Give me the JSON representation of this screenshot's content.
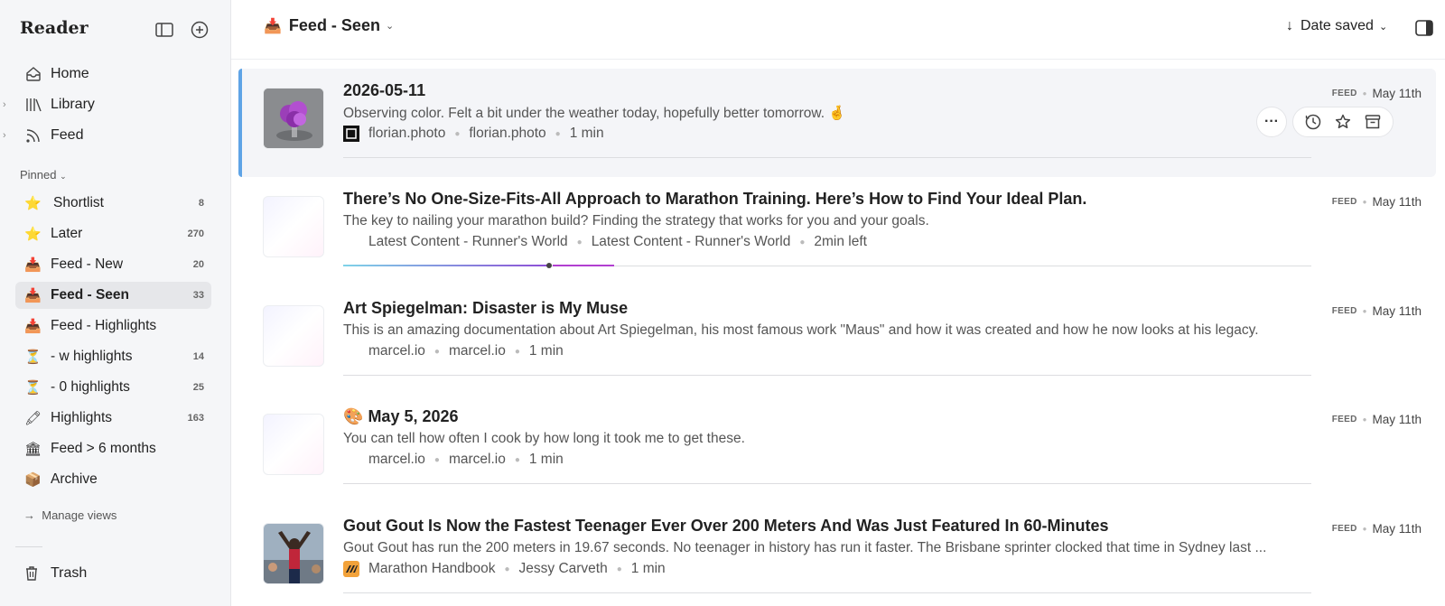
{
  "sidebar": {
    "app_title": "Reader",
    "nav": [
      {
        "label": "Home",
        "icon": "home-icon",
        "expandable": false
      },
      {
        "label": "Library",
        "icon": "library-icon",
        "expandable": true
      },
      {
        "label": "Feed",
        "icon": "rss-icon",
        "expandable": true
      }
    ],
    "pinned_label": "Pinned",
    "views": [
      {
        "label": "Shortlist",
        "count": "8",
        "icon": "star-icon",
        "glyph": "⭐"
      },
      {
        "label": "Later",
        "count": "270",
        "icon": "star-icon",
        "glyph": "⭐"
      },
      {
        "label": "Feed - New",
        "count": "20",
        "icon": "inbox-tray-icon",
        "glyph": "📥"
      },
      {
        "label": "Feed - Seen",
        "count": "33",
        "icon": "inbox-tray-icon",
        "glyph": "📥",
        "active": true
      },
      {
        "label": "Feed - Highlights",
        "count": "",
        "icon": "inbox-tray-icon",
        "glyph": "📥"
      },
      {
        "label": "- w highlights",
        "count": "14",
        "icon": "hourglass-icon",
        "glyph": "⏳"
      },
      {
        "label": "- 0 highlights",
        "count": "25",
        "icon": "hourglass-icon",
        "glyph": "⏳"
      },
      {
        "label": "Highlights",
        "count": "163",
        "icon": "pen-icon",
        "glyph": "🖍"
      },
      {
        "label": "Feed > 6 months",
        "count": "",
        "icon": "building-icon",
        "glyph": "🏛"
      },
      {
        "label": "Archive",
        "count": "",
        "icon": "package-icon",
        "glyph": "📦"
      }
    ],
    "manage_views": "Manage views",
    "trash": "Trash"
  },
  "header": {
    "view_title": "Feed - Seen",
    "view_icon": "inbox-tray-icon",
    "sort_label": "Date saved"
  },
  "documents": [
    {
      "title": "2026-05-11",
      "description": "Observing color. Felt a bit under the weather today, hopefully better tomorrow. 🤞",
      "site": "florian.photo",
      "author": "florian.photo",
      "reading": "1 min",
      "source_tag": "FEED",
      "date": "May 11th",
      "thumbnail": "flower-photo",
      "selected": true
    },
    {
      "title": "There’s No One-Size-Fits-All Approach to Marathon Training. Here’s How to Find Your Ideal Plan.",
      "description": "The key to nailing your marathon build? Finding the strategy that works for you and your goals.",
      "site": "Latest Content - Runner's World",
      "author": "Latest Content - Runner's World",
      "reading": "2min left",
      "source_tag": "FEED",
      "date": "May 11th",
      "thumbnail": "blank",
      "progress": 0.28
    },
    {
      "title": "Art Spiegelman: Disaster is My Muse",
      "description": "This is an amazing documentation about Art Spiegelman, his most famous work \"Maus\" and how it was created and how he now looks at his legacy.",
      "site": "marcel.io",
      "author": "marcel.io",
      "reading": "1 min",
      "source_tag": "FEED",
      "date": "May 11th",
      "thumbnail": "blank"
    },
    {
      "title_emoji": "🎨",
      "title": "May 5, 2026",
      "description": "You can tell how often I cook by how long it took me to get these.",
      "site": "marcel.io",
      "author": "marcel.io",
      "reading": "1 min",
      "source_tag": "FEED",
      "date": "May 11th",
      "thumbnail": "blank"
    },
    {
      "title": "Gout Gout Is Now the Fastest Teenager Ever Over 200 Meters And Was Just Featured In 60-Minutes",
      "description": "Gout Gout has run the 200 meters in 19.67 seconds. No teenager in history has run it faster. The Brisbane sprinter clocked that time in Sydney last ...",
      "site": "Marathon Handbook",
      "author": "Jessy Carveth",
      "reading": "1 min",
      "source_tag": "FEED",
      "date": "May 11th",
      "thumbnail": "runner-photo"
    }
  ],
  "row_actions": {
    "more": "···",
    "icons": [
      "clock-icon",
      "star-icon",
      "archive-icon"
    ]
  },
  "colors": {
    "accent": "#5fa4e6",
    "progress_start": "#7fd3e8",
    "progress_end": "#b13fd0",
    "sidebar_bg": "#f5f6f8"
  }
}
